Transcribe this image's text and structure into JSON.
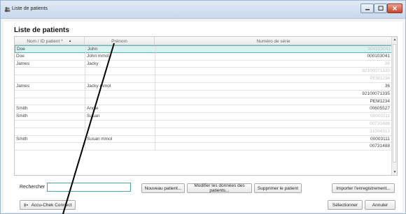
{
  "window": {
    "title": "Liste de patients",
    "icon": "users-icon"
  },
  "heading": "Liste de patients",
  "table": {
    "columns": [
      "Nom / ID patient *",
      "Prénom",
      "Numéro de série"
    ],
    "sort_indicator": "▲",
    "rows": [
      {
        "nom": "Doe",
        "prenom": "John",
        "serie": "000103041",
        "faded": true,
        "selected": true
      },
      {
        "nom": "Doe",
        "prenom": "John mmol",
        "serie": "000103041",
        "faded": false,
        "selected": false
      },
      {
        "nom": "James",
        "prenom": "Jacky",
        "serie": "36",
        "faded": true,
        "selected": false
      },
      {
        "nom": "",
        "prenom": "",
        "serie": "92100071335",
        "faded": true,
        "selected": false
      },
      {
        "nom": "",
        "prenom": "",
        "serie": "PEM1234",
        "faded": true,
        "selected": false
      },
      {
        "nom": "James",
        "prenom": "Jacky mmol",
        "serie": "36",
        "faded": false,
        "selected": false
      },
      {
        "nom": "",
        "prenom": "",
        "serie": "92100071335",
        "faded": false,
        "selected": false
      },
      {
        "nom": "",
        "prenom": "",
        "serie": "PEM1234",
        "faded": false,
        "selected": false
      },
      {
        "nom": "Smith",
        "prenom": "Angie",
        "serie": "00605527",
        "faded": false,
        "selected": false
      },
      {
        "nom": "Smith",
        "prenom": "Susan",
        "serie": "00003111",
        "faded": true,
        "selected": false
      },
      {
        "nom": "",
        "prenom": "",
        "serie": "00731488",
        "faded": true,
        "selected": false
      },
      {
        "nom": "",
        "prenom": "",
        "serie": "31004313",
        "faded": true,
        "selected": false
      },
      {
        "nom": "Smith",
        "prenom": "Susan mmol",
        "serie": "00003111",
        "faded": false,
        "selected": false
      },
      {
        "nom": "",
        "prenom": "",
        "serie": "00731488",
        "faded": false,
        "selected": false
      }
    ]
  },
  "search": {
    "label": "Rechercher",
    "value": ""
  },
  "buttons": {
    "new_patient": "Nouveau patient...",
    "edit_patient": "Modifier les données des patients...",
    "delete_patient": "Supprimer le patient",
    "import_record": "Importer l'enregistrement...",
    "connect": "Accu-Chek Connect",
    "select": "Sélectionner",
    "cancel": "Annuler"
  },
  "colors": {
    "selected_row": "#d9f1f1",
    "accent": "#4fa3a3"
  }
}
